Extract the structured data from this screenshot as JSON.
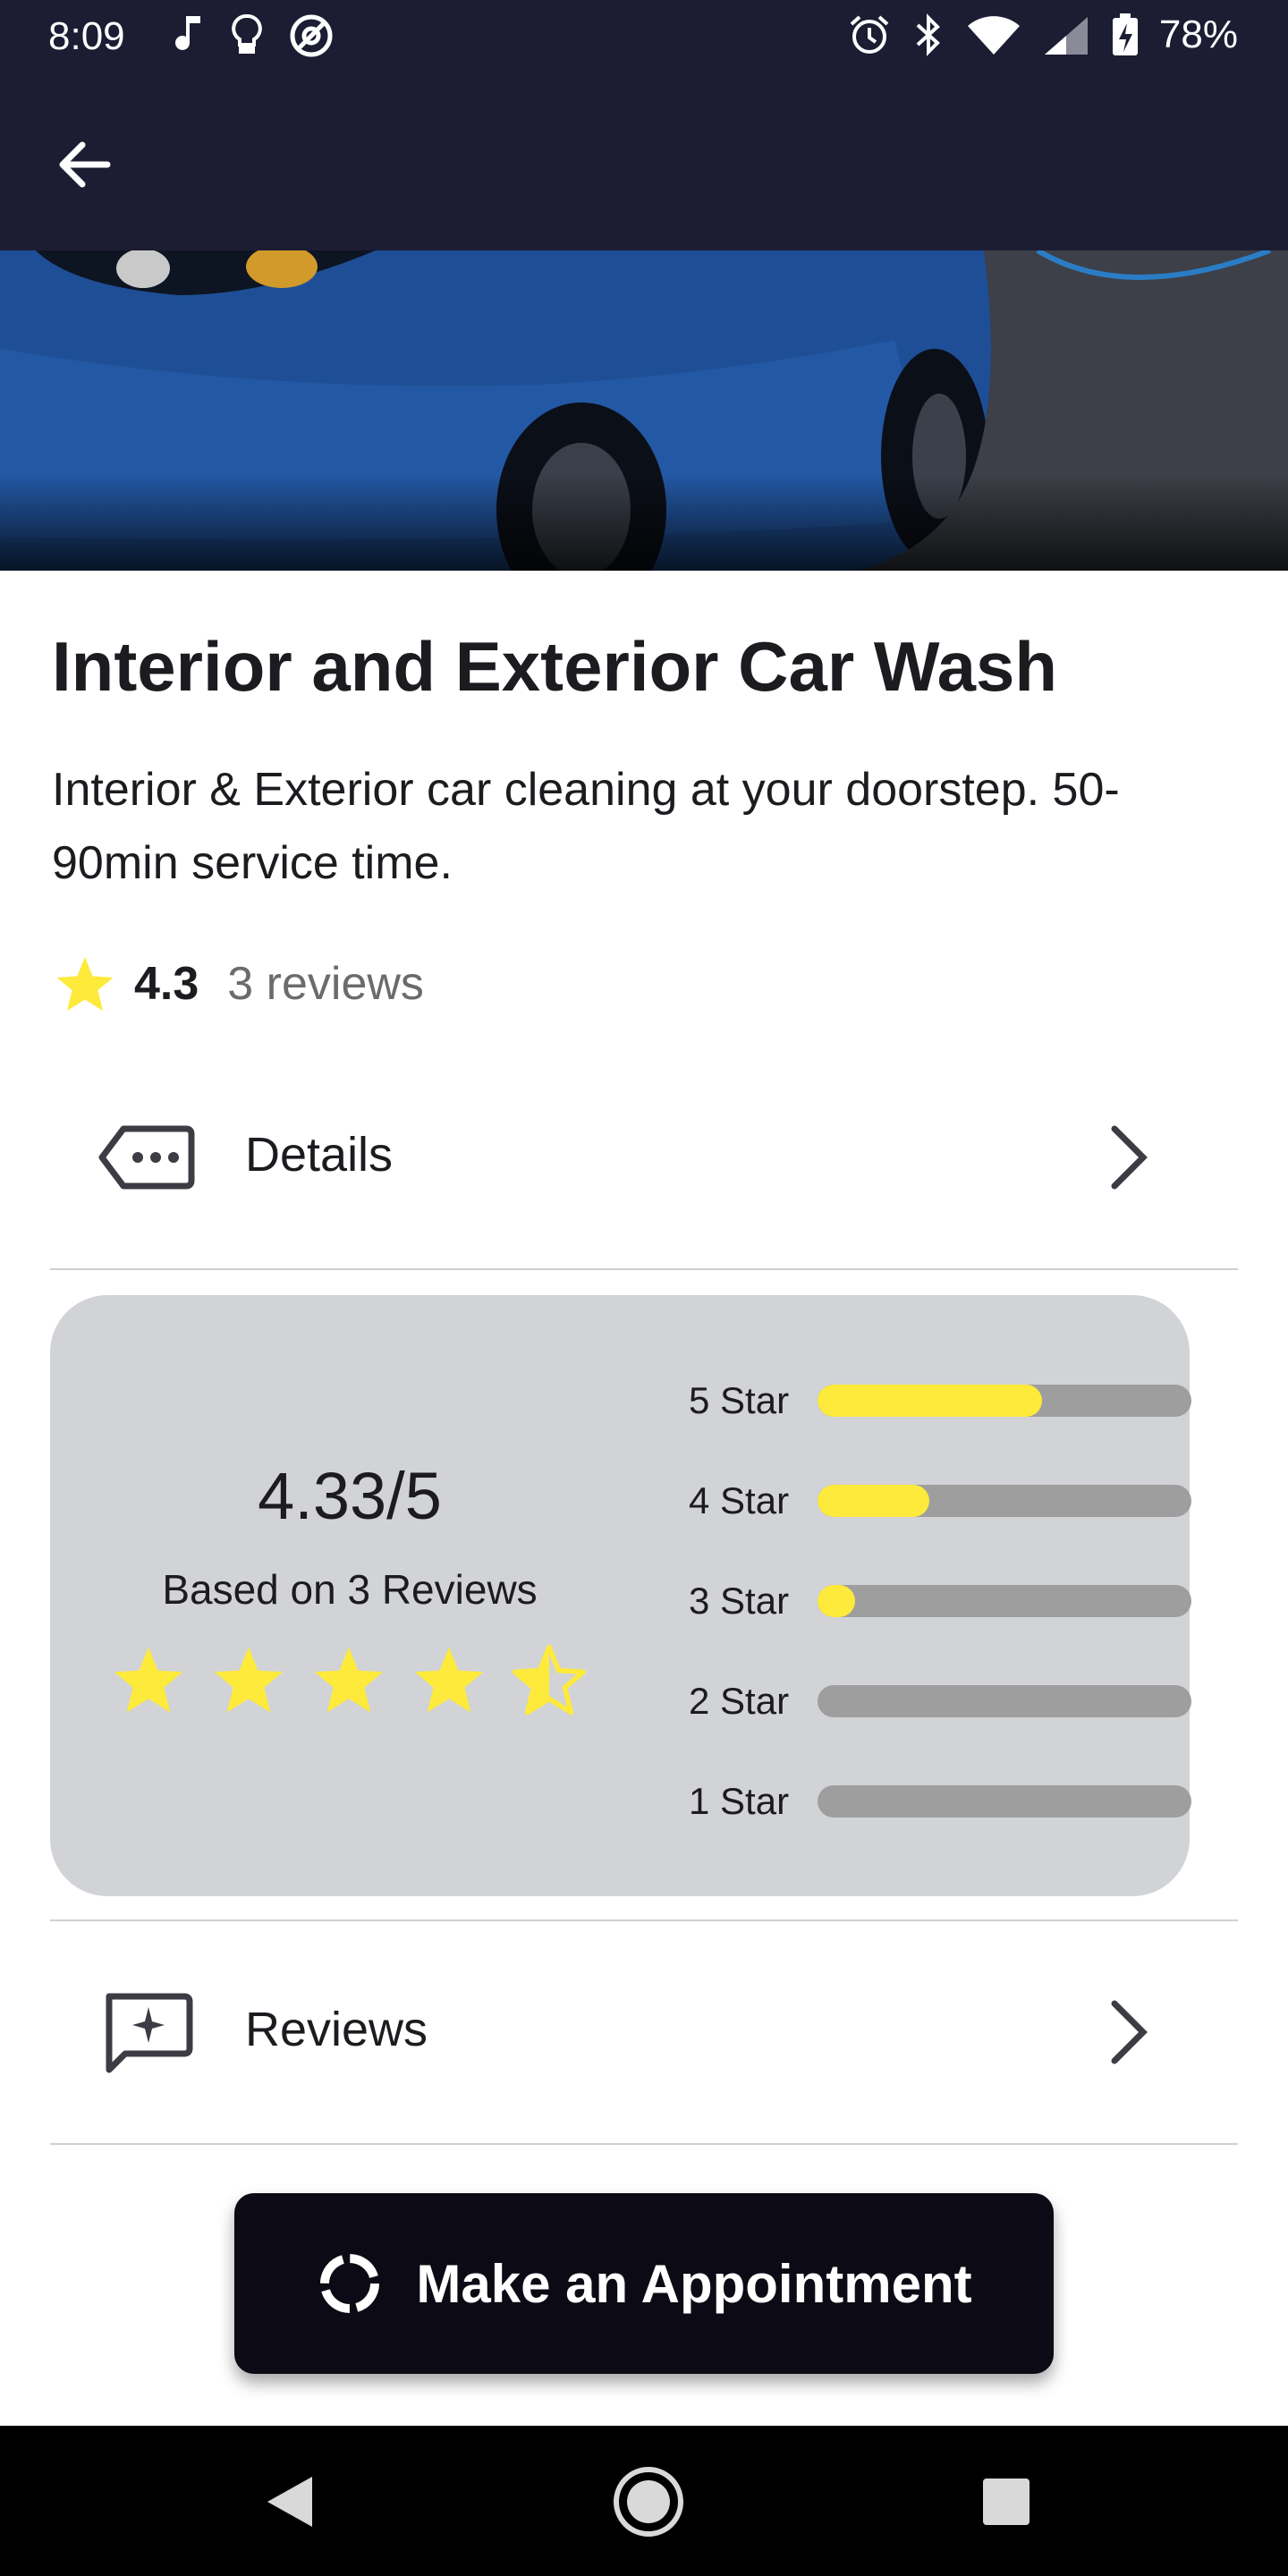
{
  "status_bar": {
    "time": "8:09",
    "battery": "78%",
    "left_icons": [
      "music-note-icon",
      "lightbulb-icon",
      "at-sign-icon"
    ],
    "right_icons": [
      "alarm-icon",
      "bluetooth-icon",
      "wifi-icon",
      "signal-icon",
      "battery-charging-icon"
    ]
  },
  "app_bar": {
    "back_icon": "arrow-back-icon"
  },
  "service": {
    "title": "Interior and Exterior Car Wash",
    "description": "Interior & Exterior car cleaning at your doorstep. 50-90min service time.",
    "rating": "4.3",
    "reviews_count": "3 reviews"
  },
  "details_row": {
    "label": "Details",
    "icon": "label-more-icon"
  },
  "ratings_summary": {
    "score": "4.33/5",
    "based_on": "Based on 3 Reviews",
    "star_rating": 4.33,
    "star_color": "#fdea3b",
    "bars": [
      {
        "label": "5 Star",
        "fraction": 0.6
      },
      {
        "label": "4 Star",
        "fraction": 0.3
      },
      {
        "label": "3 Star",
        "fraction": 0.1
      },
      {
        "label": "2 Star",
        "fraction": 0.0
      },
      {
        "label": "1 Star",
        "fraction": 0.0
      }
    ]
  },
  "reviews_row": {
    "label": "Reviews",
    "icon": "review-chat-icon"
  },
  "cta": {
    "label": "Make an Appointment",
    "icon": "loading-spinner-icon"
  },
  "colors": {
    "app_bar": "#1c1d33",
    "accent_yellow": "#fdea3b",
    "cta_bg": "#0c0a14"
  }
}
